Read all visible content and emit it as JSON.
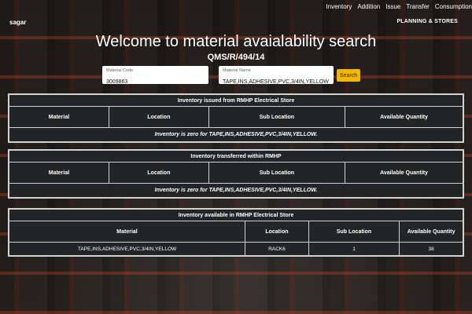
{
  "nav": {
    "items": [
      "Inventory",
      "Addition",
      "Issue",
      "Transfer",
      "Consumption"
    ]
  },
  "brand": "sagar",
  "planning": "PLANNING & STORES",
  "title": "Welcome to material avaialability search",
  "subtitle": "QMS/R/494/14",
  "search": {
    "material_code_label": "Material Code",
    "material_code_value": "3009863",
    "material_name_label": "Material Name",
    "material_name_value": "TAPE,INS,ADHESIVE,PVC,3/4IN,YELLOW",
    "button_label": "Search"
  },
  "issued": {
    "title": "Inventory issued from RMHP Electrical Store",
    "headers": [
      "Material",
      "Location",
      "Sub Location",
      "Available Quantity"
    ],
    "message": "Inventory is zero for TAPE,INS,ADHESIVE,PVC,3/4IN,YELLOW."
  },
  "transferred": {
    "title": "Inventory transferred within RMHP",
    "headers": [
      "Material",
      "Location",
      "Sub Location",
      "Available Quantity"
    ],
    "message": "Inventory is zero for TAPE,INS,ADHESIVE,PVC,3/4IN,YELLOW."
  },
  "available": {
    "title": "Inventory available in RMHP Electrical Store",
    "headers": [
      "Material",
      "Location",
      "Sub Location",
      "Available Quantity"
    ],
    "rows": [
      {
        "material": "TAPE,INS,ADHESIVE,PVC,3/4IN,YELLOW",
        "location": "RACK6",
        "sub_location": "1",
        "quantity": "38"
      }
    ]
  },
  "colors": {
    "button": "#f2b705",
    "card_bg": "#222426",
    "border": "#cfd3d6"
  }
}
